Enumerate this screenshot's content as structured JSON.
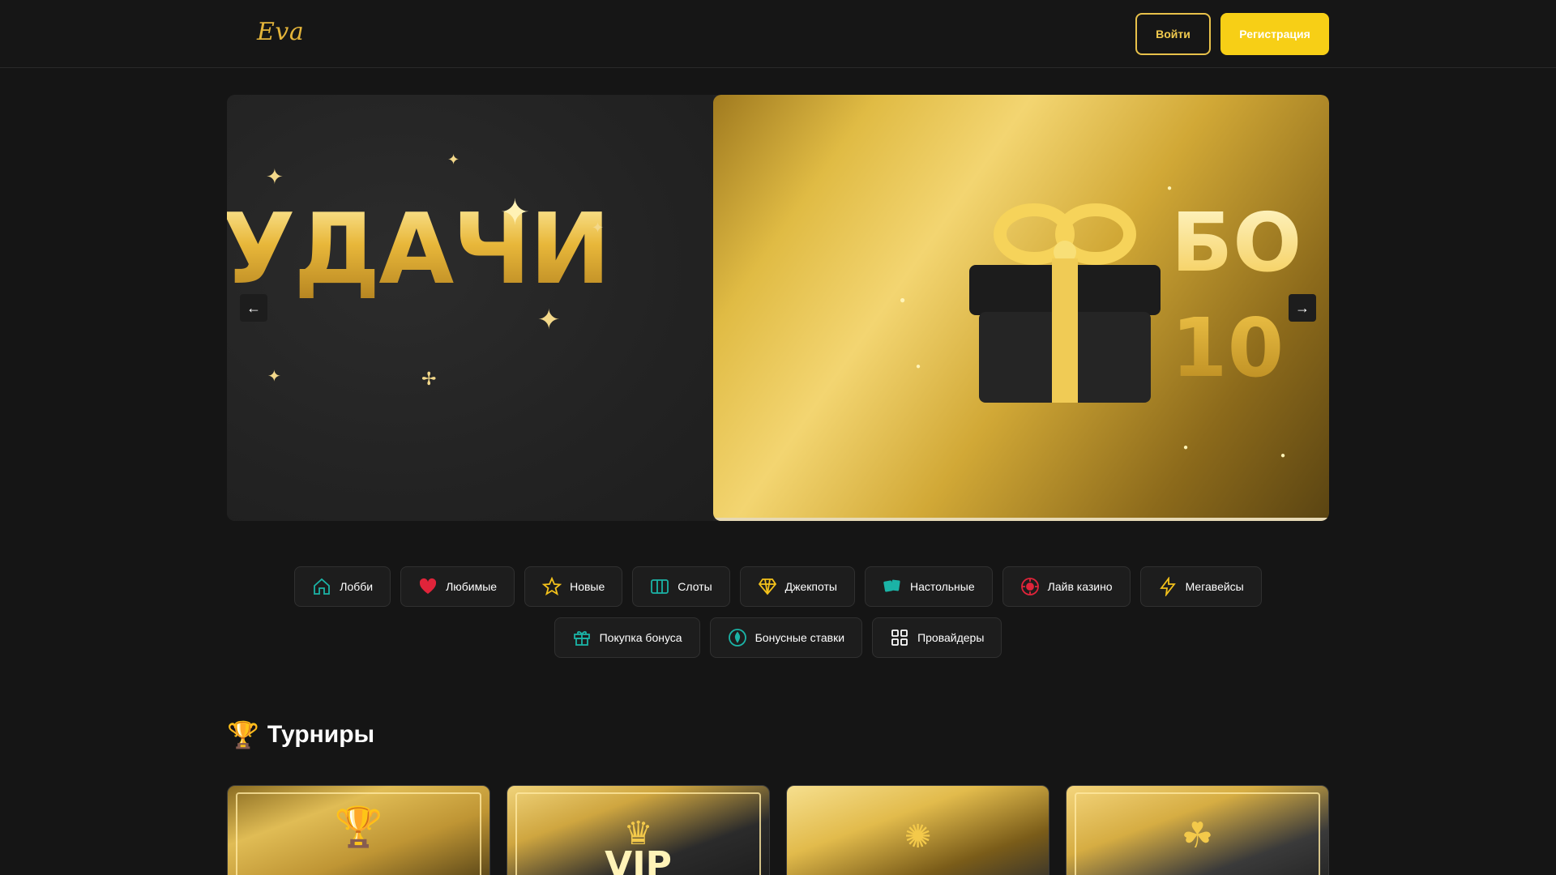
{
  "header": {
    "logo": "Eva",
    "login_label": "Войти",
    "register_label": "Регистрация"
  },
  "carousel": {
    "slide_left_text": "УДАЧИ",
    "slide_right_text_line1": "БО",
    "slide_right_text_line2": "10",
    "prev_icon": "arrow-left-icon",
    "next_icon": "arrow-right-icon"
  },
  "categories": {
    "row1": [
      {
        "label": "Лобби",
        "icon": "home-icon",
        "color": "#1bb3a6"
      },
      {
        "label": "Любимые",
        "icon": "heart-icon",
        "color": "#e0243a"
      },
      {
        "label": "Новые",
        "icon": "star-icon",
        "color": "#f3c11b"
      },
      {
        "label": "Слоты",
        "icon": "slots-icon",
        "color": "#1bb3a6"
      },
      {
        "label": "Джекпоты",
        "icon": "diamond-icon",
        "color": "#f3c11b"
      },
      {
        "label": "Настольные",
        "icon": "cards-icon",
        "color": "#1bb3a6"
      },
      {
        "label": "Лайв казино",
        "icon": "chip-icon",
        "color": "#e0243a"
      },
      {
        "label": "Мегавейсы",
        "icon": "lightning-icon",
        "color": "#f3c11b"
      }
    ],
    "row2": [
      {
        "label": "Покупка бонуса",
        "icon": "gift-icon",
        "color": "#1bb3a6"
      },
      {
        "label": "Бонусные ставки",
        "icon": "coin-icon",
        "color": "#1bb3a6"
      },
      {
        "label": "Провайдеры",
        "icon": "grid-icon",
        "color": "#ffffff"
      }
    ]
  },
  "tournaments": {
    "title": "Турниры",
    "title_icon": "trophy-icon",
    "cards": [
      {
        "emblem": "trophy-icon"
      },
      {
        "emblem": "crown-icon",
        "text": "VIP"
      },
      {
        "emblem": "cup-fireworks-icon"
      },
      {
        "emblem": "clover-icon"
      }
    ]
  },
  "colors": {
    "background": "#151515",
    "accent": "#f7cf16",
    "gold": "#e3b43a"
  }
}
